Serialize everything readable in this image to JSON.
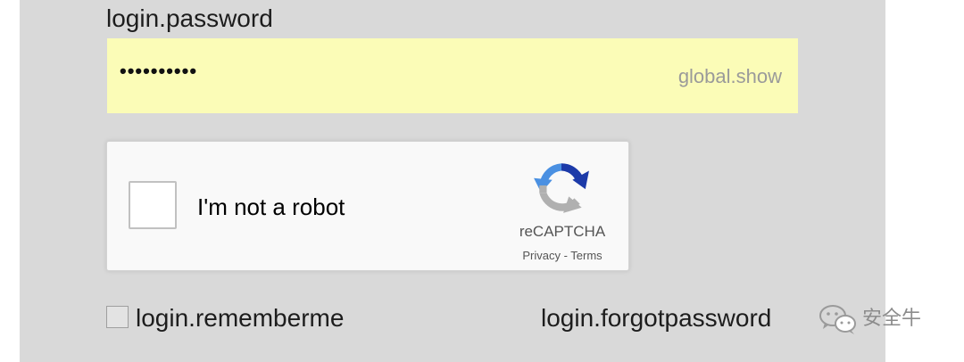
{
  "login": {
    "password_label": "login.password",
    "password_value": "••••••••••",
    "show_label": "global.show",
    "remember_label": "login.rememberme",
    "remember_checked": false,
    "forgot_label": "login.forgotpassword"
  },
  "recaptcha": {
    "label": "I'm not a robot",
    "brand": "reCAPTCHA",
    "privacy_label": "Privacy",
    "separator": " - ",
    "terms_label": "Terms",
    "checked": false,
    "icon": "recaptcha-logo-icon"
  },
  "watermark": {
    "text": "安全牛",
    "icon": "wechat-icon"
  },
  "colors": {
    "panel_bg": "#d9d9d9",
    "password_field_bg": "#fbfcb7",
    "recaptcha_blue": "#4a90e2",
    "recaptcha_dark_blue": "#1c3aa9",
    "recaptcha_gray": "#b0b0b0"
  }
}
